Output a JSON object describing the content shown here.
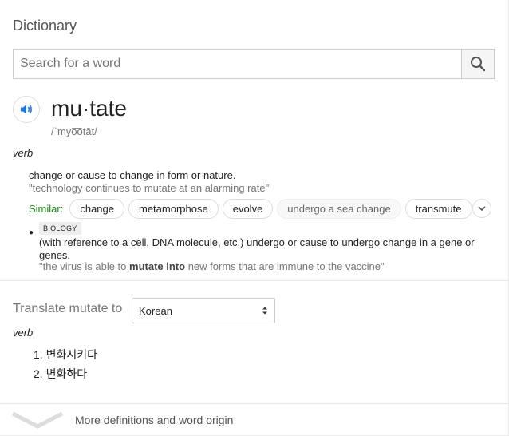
{
  "header": {
    "title": "Dictionary"
  },
  "search": {
    "placeholder": "Search for a word"
  },
  "entry": {
    "word": "mu·tate",
    "phonetic": "/ˈmyo͞otāt/",
    "part_of_speech": "verb",
    "sense1": {
      "definition": "change or cause to change in form or nature.",
      "example": "\"technology continues to mutate at an alarming rate\""
    },
    "similar": {
      "label": "Similar:",
      "chips": [
        "change",
        "metamorphose",
        "evolve",
        "undergo a sea change",
        "transmute"
      ]
    },
    "sense2": {
      "badge": "BIOLOGY",
      "definition": "(with reference to a cell, DNA molecule, etc.) undergo or cause to undergo change in a gene or genes.",
      "example_before": "\"the virus is able to ",
      "example_bold": "mutate into",
      "example_after": " new forms that are immune to the vaccine\""
    }
  },
  "translate": {
    "label": "Translate mutate to",
    "language": "Korean",
    "part_of_speech": "verb",
    "items": [
      "1. 변화시키다",
      "2. 변화하다"
    ]
  },
  "footer": {
    "more_label": "More definitions and word origin"
  },
  "icons": {
    "search": "search-icon",
    "speaker": "speaker-icon",
    "expand": "chevron-down-icon",
    "select": "select-arrows-icon",
    "more": "chevron-down-icon"
  },
  "colors": {
    "accent_blue": "#1a73e8",
    "similar_green": "#1a8d1a"
  }
}
